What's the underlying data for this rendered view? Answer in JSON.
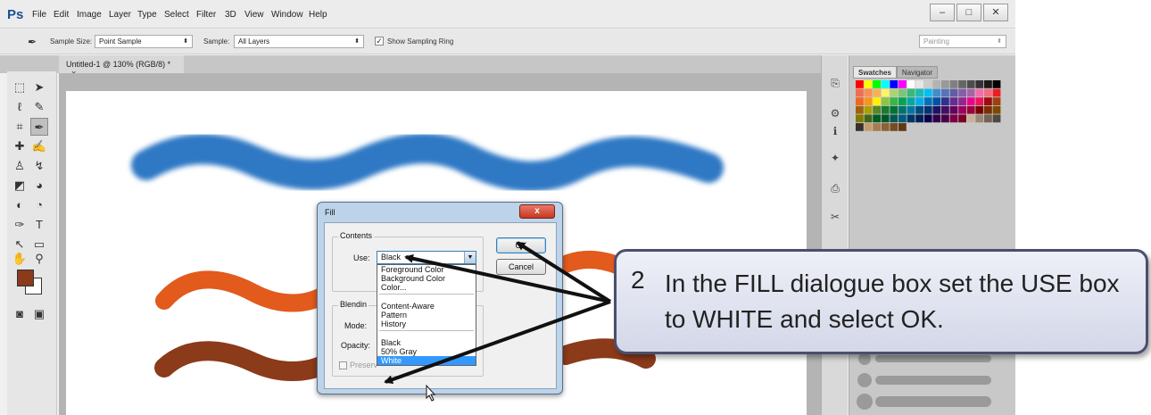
{
  "app": {
    "logo": "Ps",
    "menu": [
      "File",
      "Edit",
      "Image",
      "Layer",
      "Type",
      "Select",
      "Filter",
      "3D",
      "View",
      "Window",
      "Help"
    ],
    "window_controls": [
      "–",
      "□",
      "✕"
    ]
  },
  "options_bar": {
    "sample_size_label": "Sample Size:",
    "sample_size_value": "Point Sample",
    "sample_label": "Sample:",
    "sample_value": "All Layers",
    "show_ring_label": "Show Sampling Ring",
    "show_ring_checked": true,
    "workspace_value": "Painting"
  },
  "document": {
    "tab_title": "Untitled-1 @ 130% (RGB/8) *",
    "tab_close": "×"
  },
  "panel": {
    "tabs": [
      "Swatches",
      "Navigator"
    ]
  },
  "fill_dialog": {
    "title": "Fill",
    "close": "x",
    "contents_group": "Contents",
    "use_label": "Use:",
    "use_value": "Black",
    "blending_group": "Blendin",
    "mode_label": "Mode:",
    "opacity_label": "Opacity:",
    "preserve_label": "Preserv",
    "ok": "OK",
    "cancel": "Cancel",
    "use_options": [
      "Foreground Color",
      "Background Color",
      "Color...",
      "Content-Aware",
      "Pattern",
      "History",
      "Black",
      "50% Gray",
      "White"
    ],
    "selected_option": "White"
  },
  "callout": {
    "number": "2",
    "text": "In the FILL dialogue box set the USE box to WHITE and select OK."
  },
  "colors": {
    "blue_stroke": "#2f78c4",
    "orange_stroke": "#e25a1c",
    "brown_stroke": "#8b3a1a",
    "foreground": "#8b3a1a",
    "background": "#ffffff",
    "selection": "#3399ff"
  },
  "icons": {
    "toolbox": [
      "marquee-icon",
      "move-icon",
      "lasso-icon",
      "quick-select-icon",
      "crop-icon",
      "eyedropper-icon",
      "healing-icon",
      "brush-icon",
      "stamp-icon",
      "history-brush-icon",
      "eraser-icon",
      "bucket-icon",
      "blur-icon",
      "dodge-icon",
      "pen-icon",
      "type-icon",
      "path-select-icon",
      "shape-icon",
      "hand-icon",
      "zoom-icon"
    ],
    "panel_strip": [
      "history-icon",
      "adjust-icon",
      "info-icon",
      "brush-preset-icon",
      "clone-source-icon",
      "tool-preset-icon"
    ]
  }
}
